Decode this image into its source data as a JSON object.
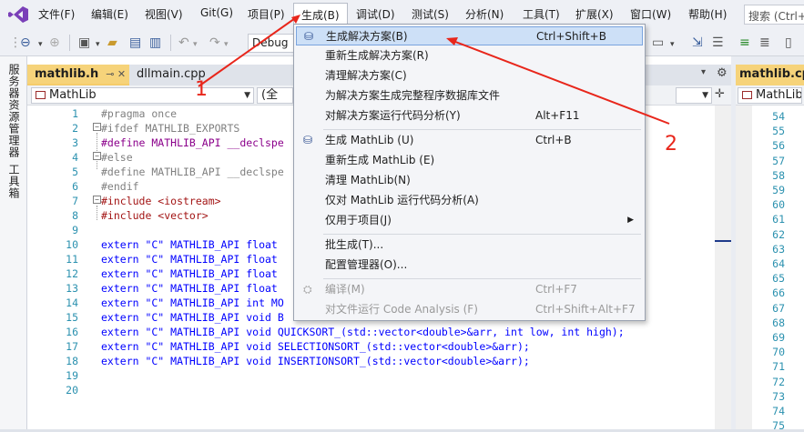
{
  "menubar": {
    "items": [
      "文件(F)",
      "编辑(E)",
      "视图(V)",
      "Git(G)",
      "项目(P)",
      "生成(B)",
      "调试(D)",
      "测试(S)",
      "分析(N)",
      "工具(T)",
      "扩展(X)",
      "窗口(W)",
      "帮助(H)"
    ],
    "search_placeholder": "搜索 (Ctrl+"
  },
  "toolbar": {
    "config_combo": "Debug"
  },
  "left_strip": {
    "tabs": [
      "服务器资源管理器",
      "工具箱"
    ]
  },
  "editor": {
    "tabs": [
      {
        "label": "mathlib.h",
        "pin": "⊸ ✕",
        "active": true
      },
      {
        "label": "dllmain.cpp",
        "active": false
      }
    ],
    "nav_left": "MathLib",
    "nav_mid": "(全",
    "lines": [
      {
        "n": "1",
        "text": "#pragma once"
      },
      {
        "n": "2",
        "text": "#ifdef MATHLIB_EXPORTS"
      },
      {
        "n": "3",
        "text": "#define MATHLIB_API __declspe"
      },
      {
        "n": "4",
        "text": "#else"
      },
      {
        "n": "5",
        "text": "#define MATHLIB_API __declspe"
      },
      {
        "n": "6",
        "text": "#endif"
      },
      {
        "n": "7",
        "text": "#include <iostream>"
      },
      {
        "n": "8",
        "text": "#include <vector>"
      },
      {
        "n": "9",
        "text": ""
      },
      {
        "n": "10",
        "text": "extern \"C\" MATHLIB_API float"
      },
      {
        "n": "11",
        "text": "extern \"C\" MATHLIB_API float"
      },
      {
        "n": "12",
        "text": "extern \"C\" MATHLIB_API float"
      },
      {
        "n": "13",
        "text": "extern \"C\" MATHLIB_API float"
      },
      {
        "n": "14",
        "text": "extern \"C\" MATHLIB_API int MO"
      },
      {
        "n": "15",
        "text": "extern \"C\" MATHLIB_API void B"
      },
      {
        "n": "16",
        "text": "extern \"C\" MATHLIB_API void QUICKSORT_(std::vector<double>&arr, int low, int high);"
      },
      {
        "n": "17",
        "text": "extern \"C\" MATHLIB_API void SELECTIONSORT_(std::vector<double>&arr);"
      },
      {
        "n": "18",
        "text": "extern \"C\" MATHLIB_API void INSERTIONSORT_(std::vector<double>&arr);"
      },
      {
        "n": "19",
        "text": ""
      },
      {
        "n": "20",
        "text": ""
      }
    ]
  },
  "right_pane": {
    "tab_label": "mathlib.cpp",
    "nav_label": "MathLib",
    "line_numbers": [
      "54",
      "55",
      "56",
      "57",
      "58",
      "59",
      "60",
      "61",
      "62",
      "63",
      "64",
      "65",
      "66",
      "67",
      "68",
      "69",
      "70",
      "71",
      "72",
      "73",
      "74",
      "75"
    ]
  },
  "build_menu": {
    "items": [
      {
        "label": "生成解决方案(B)",
        "shortcut": "Ctrl+Shift+B",
        "icon": "build-solution-icon",
        "highlighted": true
      },
      {
        "label": "重新生成解决方案(R)",
        "shortcut": ""
      },
      {
        "label": "清理解决方案(C)",
        "shortcut": ""
      },
      {
        "label": "为解决方案生成完整程序数据库文件",
        "shortcut": ""
      },
      {
        "label": "对解决方案运行代码分析(Y)",
        "shortcut": "Alt+F11"
      },
      {
        "label": "生成 MathLib (U)",
        "shortcut": "Ctrl+B",
        "icon": "build-project-icon"
      },
      {
        "label": "重新生成 MathLib (E)",
        "shortcut": ""
      },
      {
        "label": "清理 MathLib(N)",
        "shortcut": ""
      },
      {
        "label": "仅对 MathLib 运行代码分析(A)",
        "shortcut": ""
      },
      {
        "label": "仅用于项目(J)",
        "shortcut": "",
        "submenu": true
      },
      {
        "label": "批生成(T)...",
        "shortcut": ""
      },
      {
        "label": "配置管理器(O)...",
        "shortcut": ""
      },
      {
        "label": "编译(M)",
        "shortcut": "Ctrl+F7",
        "disabled": true,
        "icon": "compile-icon"
      },
      {
        "label": "对文件运行 Code Analysis (F)",
        "shortcut": "Ctrl+Shift+Alt+F7",
        "disabled": true
      }
    ]
  },
  "annotations": {
    "label_1": "1",
    "label_2": "2",
    "color": "#e8261b"
  }
}
